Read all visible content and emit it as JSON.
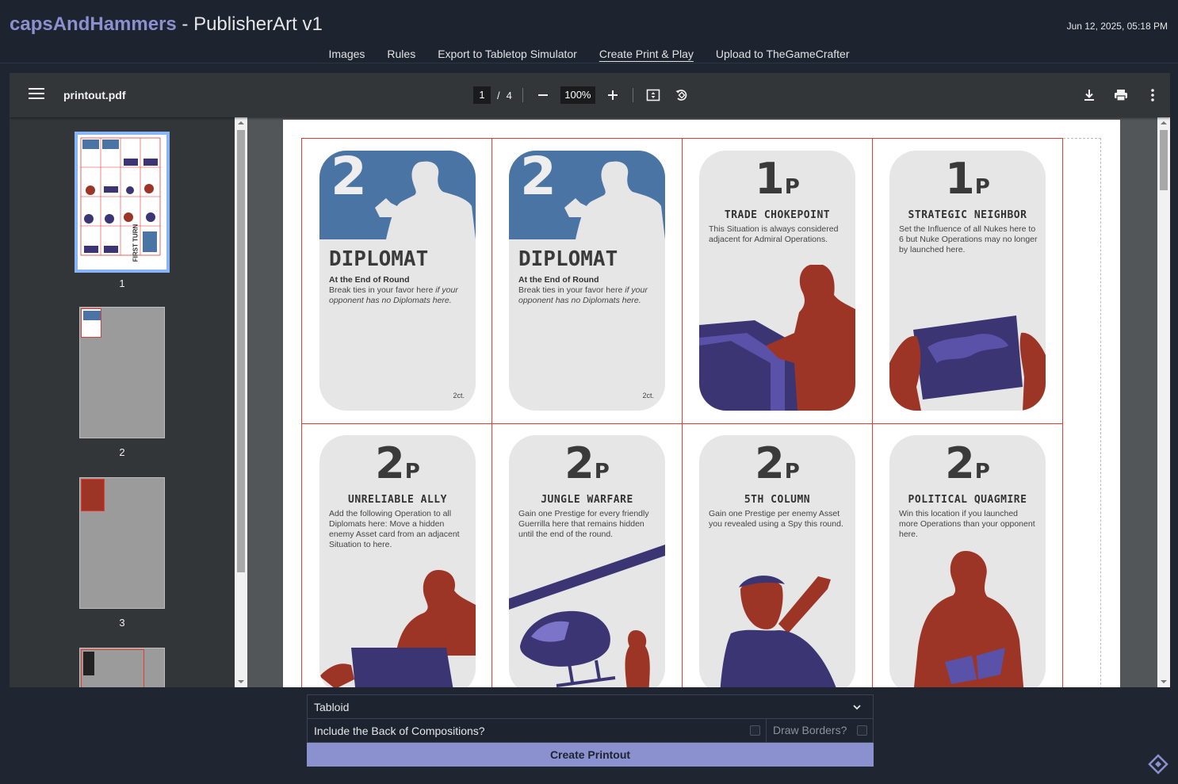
{
  "header": {
    "brand": "capsAndHammers",
    "title_rest": " - PublisherArt v1",
    "timestamp": "Jun 12, 2025, 05:18 PM"
  },
  "nav": {
    "items": [
      "Images",
      "Rules",
      "Export to Tabletop Simulator",
      "Create Print & Play",
      "Upload to TheGameCrafter"
    ],
    "active": "Create Print & Play"
  },
  "viewer": {
    "filename": "printout.pdf",
    "current_page": "1",
    "page_sep": "/",
    "total_pages": "4",
    "zoom": "100%"
  },
  "thumbnails": {
    "labels": [
      "1",
      "2",
      "3"
    ],
    "first_turn": "FIRST TURN"
  },
  "cards": {
    "diplomat_number": "2",
    "diplomat_title": "DIPLOMAT",
    "diplomat_sub": "At the End of Round",
    "diplomat_text_plain": "Break ties in your favor here ",
    "diplomat_text_italic": "if your opponent has no Diplomats here.",
    "diplomat_count": "2ct.",
    "p_suffix": "P",
    "trade": {
      "num": "1",
      "title": "TRADE CHOKEPOINT",
      "text": "This Situation is always considered adjacent for Admiral Operations."
    },
    "strategic": {
      "num": "1",
      "title": "STRATEGIC NEIGHBOR",
      "text": "Set the Influence of all Nukes here to 6 but Nuke Operations may no longer by launched here."
    },
    "unreliable": {
      "num": "2",
      "title": "UNRELIABLE ALLY",
      "text": "Add the following Operation to all Diplomats here: Move a hidden enemy Asset card from an adjacent Situation to here."
    },
    "jungle": {
      "num": "2",
      "title": "JUNGLE WARFARE",
      "text": "Gain one Prestige for every friendly Guerrilla here that remains hidden until the end of the round."
    },
    "fifth": {
      "num": "2",
      "title": "5TH COLUMN",
      "text": "Gain one Prestige per enemy Asset you revealed using a Spy this round."
    },
    "political": {
      "num": "2",
      "title": "POLITICAL QUAGMIRE",
      "text": "Win this location if you launched more Operations than your opponent here."
    }
  },
  "form": {
    "paper_size": "Tabloid",
    "include_back_label": "Include the Back of Compositions?",
    "draw_borders_label": "Draw Borders?",
    "create_button": "Create Printout"
  },
  "colors": {
    "accent": "#8b90ce",
    "card_blue": "#4a74a4",
    "art_red": "#9c3526",
    "art_purple": "#3b3573"
  }
}
